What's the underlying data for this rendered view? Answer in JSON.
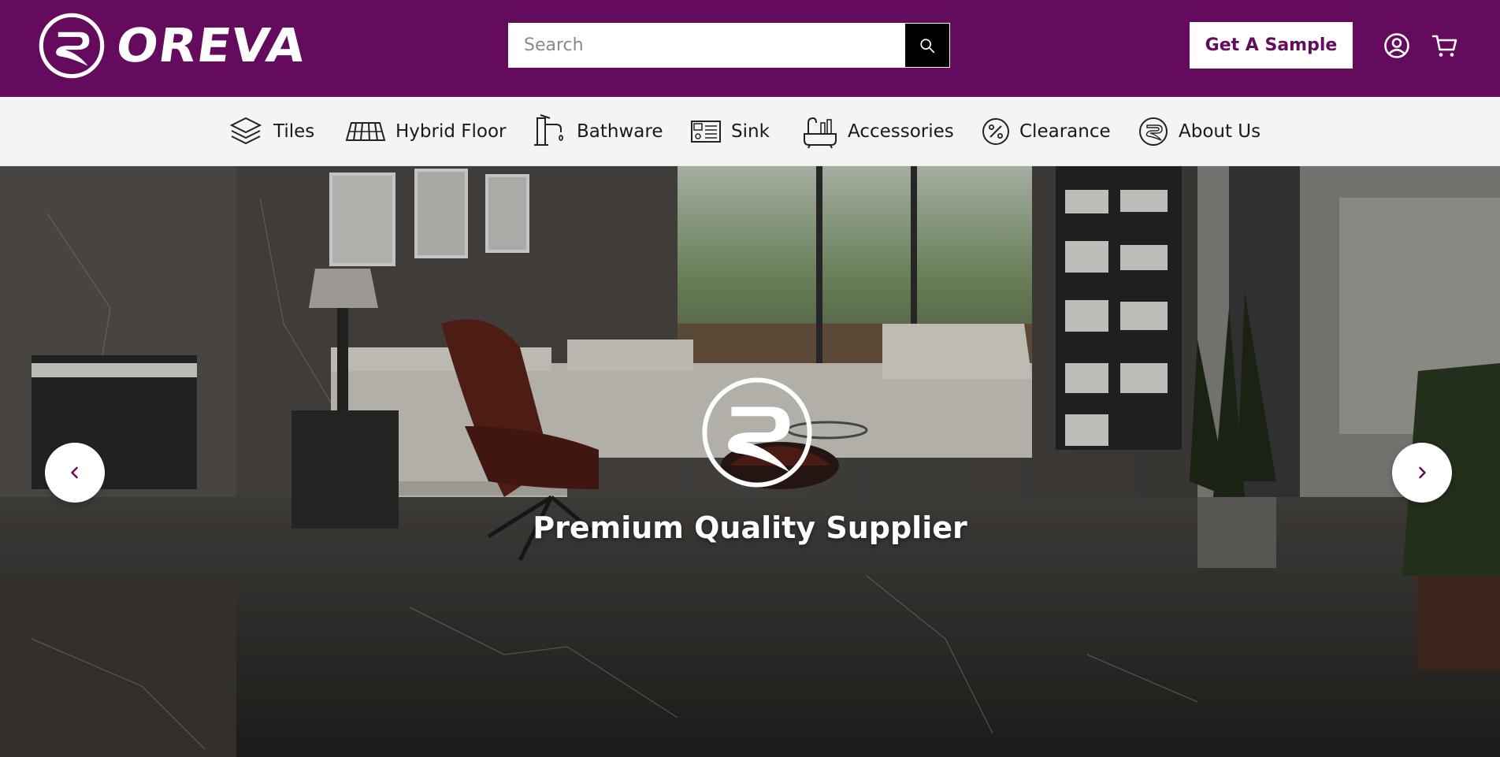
{
  "brand": {
    "name": "OREVA",
    "color": "#650b5e"
  },
  "search": {
    "placeholder": "Search",
    "value": ""
  },
  "header": {
    "sample_button": "Get A Sample",
    "icons": [
      "account-icon",
      "cart-icon",
      "search-icon"
    ]
  },
  "nav": {
    "items": [
      {
        "label": "Tiles",
        "icon": "tiles-layers-icon"
      },
      {
        "label": "Hybrid Floor",
        "icon": "floor-planks-icon"
      },
      {
        "label": "Bathware",
        "icon": "faucet-icon"
      },
      {
        "label": "Sink",
        "icon": "sink-icon"
      },
      {
        "label": "Accessories",
        "icon": "bath-accessories-icon"
      },
      {
        "label": "Clearance",
        "icon": "percent-icon"
      },
      {
        "label": "About Us",
        "icon": "oreva-logo-icon"
      }
    ]
  },
  "hero": {
    "caption": "Premium Quality Supplier",
    "controls": [
      "chevron-left-icon",
      "chevron-right-icon"
    ]
  }
}
